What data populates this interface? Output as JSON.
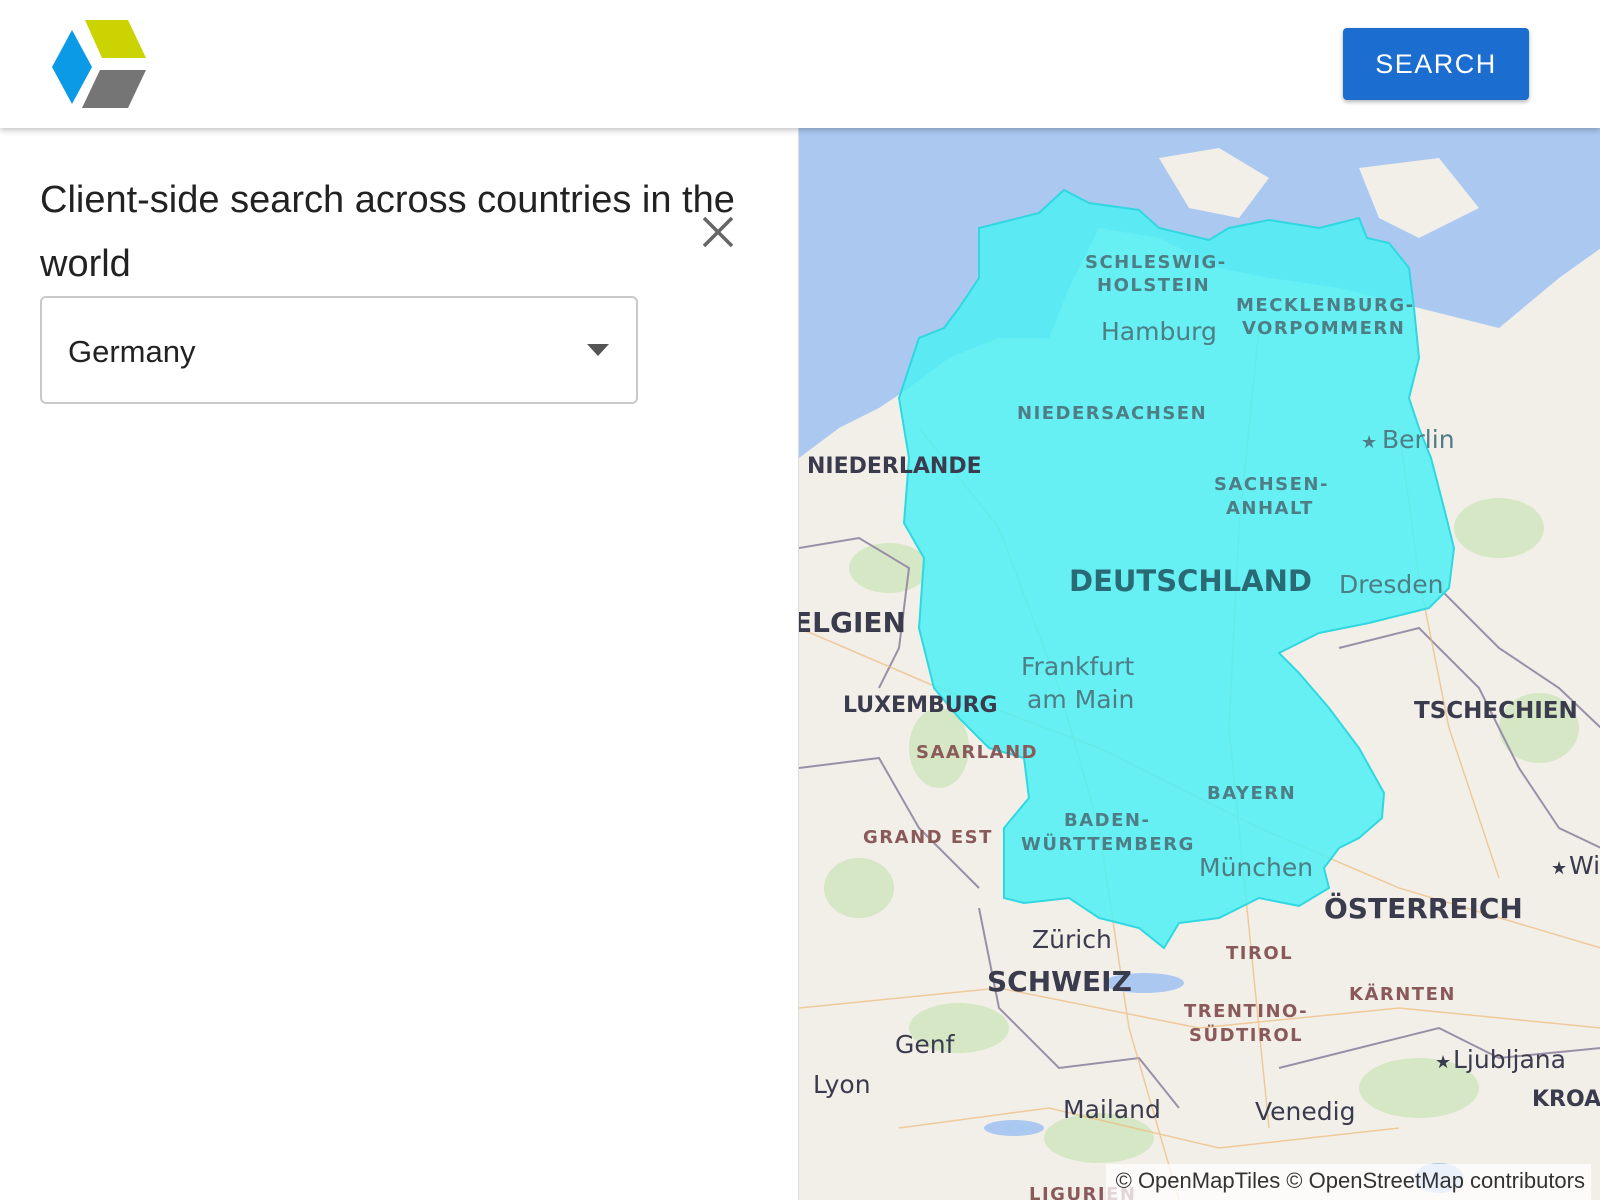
{
  "header": {
    "search_label": "SEARCH"
  },
  "panel": {
    "title": "Client-side search across countries in the world",
    "select": {
      "value": "Germany"
    }
  },
  "map": {
    "highlight_color": "#4df0f5",
    "country_labels": [
      "DEUTSCHLAND",
      "NIEDERLANDE",
      "ELGIEN",
      "LUXEMBURG",
      "TSCHECHIEN",
      "ÖSTERREICH",
      "SCHWEIZ",
      "KROA"
    ],
    "region_labels": [
      "SCHLESWIG-",
      "HOLSTEIN",
      "MECKLENBURG-",
      "VORPOMMERN",
      "NIEDERSACHSEN",
      "SACHSEN-",
      "ANHALT",
      "SAARLAND",
      "BAYERN",
      "BADEN-",
      "WÜRTTEMBERG",
      "GRAND EST",
      "TIROL",
      "KÄRNTEN",
      "TRENTINO-",
      "SÜDTIROL",
      "LIGURIEN"
    ],
    "city_labels": [
      "Hamburg",
      "Berlin",
      "Dresden",
      "Frankfurt",
      "am Main",
      "München",
      "Zürich",
      "Genf",
      "Lyon",
      "Mailand",
      "Venedig",
      "Ljubljana",
      "Wi"
    ],
    "attribution": "© OpenMapTiles © OpenStreetMap contributors"
  }
}
